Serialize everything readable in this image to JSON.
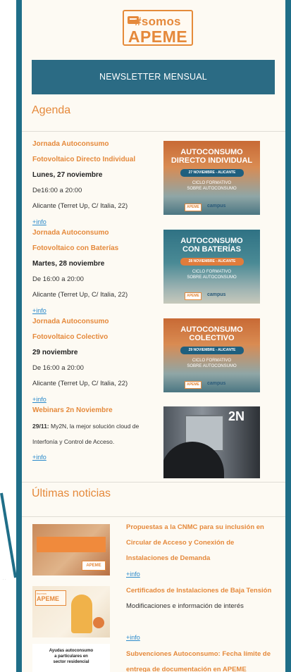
{
  "logo": {
    "line1": "#somos",
    "line2": "APEME"
  },
  "newsletter_banner": "NEWSLETTER MENSUAL",
  "agenda": {
    "title": "Agenda",
    "events": [
      {
        "title_line1": "Jornada Autoconsumo",
        "title_line2": "Fotovoltaico Directo Individual",
        "date": "Lunes, 27 noviembre",
        "time": "De16:00 a 20:00",
        "place": "Alicante (Terret Up, C/ Italia, 22)",
        "link": "+info",
        "promo": {
          "title_line1": "AUTOCONSUMO",
          "title_line2": "DIRECTO INDIVIDUAL",
          "pill": "27 NOVIEMBRE - ALICANTE",
          "sub_line1": "CICLO FORMATIVO",
          "sub_line2": "SOBRE AUTOCONSUMO",
          "footer_logo": "APEME",
          "footer_brand": "campus"
        }
      },
      {
        "title_line1": "Jornada Autoconsumo",
        "title_line2": "Fotovoltaico con Baterías",
        "date": "Martes, 28 noviembre",
        "time": "De 16:00 a 20:00",
        "place": "Alicante (Terret Up, C/ Italia, 22)",
        "link": "+info",
        "promo": {
          "title_line1": "AUTOCONSUMO",
          "title_line2": "CON BATERÍAS",
          "pill": "28 NOVIEMBRE - ALICANTE",
          "sub_line1": "CICLO FORMATIVO",
          "sub_line2": "SOBRE AUTOCONSUMO",
          "footer_logo": "APEME",
          "footer_brand": "campus"
        }
      },
      {
        "title_line1": "Jornada Autoconsumo",
        "title_line2": "Fotovoltaico Colectivo",
        "date": "29 noviembre",
        "time": "De 16:00 a 20:00",
        "place": "Alicante (Terret Up, C/ Italia, 22)",
        "link": "+info",
        "promo": {
          "title_line1": "AUTOCONSUMO",
          "title_line2": "COLECTIVO",
          "pill": "29 NOVIEMBRE - ALICANTE",
          "sub_line1": "CICLO FORMATIVO",
          "sub_line2": "SOBRE AUTOCONSUMO",
          "footer_logo": "APEME",
          "footer_brand": "campus"
        }
      },
      {
        "title_line1": "Webinars 2n Noviembre",
        "date": "29/11:",
        "desc_line1": " My2N, la mejor solución cloud de",
        "desc_line2": "Interfonía y Control de Acceso.",
        "link": "+info",
        "promo_label": "2N"
      }
    ]
  },
  "news": {
    "title": "Últimas noticias",
    "items": [
      {
        "title_line1": "Propuestas a la CNMC para su inclusión en",
        "title_line2": "Circular de Acceso y Conexión de",
        "title_line3": "Instalaciones de Demanda",
        "link": "+info",
        "image_logo": "APEME"
      },
      {
        "title_line1": "Certificados de Instalaciones de Baja Tensión",
        "text": "Modificaciones e información de interés",
        "link": "+info",
        "image_tag": "#somos",
        "image_logo": "APEME"
      },
      {
        "title_line1": "Subvenciones Autoconsumo: Fecha límite de",
        "title_line2": "entrega de documentación en APEME",
        "image_line1": "Ayudas autoconsumo",
        "image_line2": "a particulares en",
        "image_line3": "sector residencial"
      }
    ]
  },
  "colors": {
    "accent": "#e5893b",
    "brand_blue": "#2b6b84",
    "frame": "#1f6e88",
    "link": "#2b8acb"
  }
}
